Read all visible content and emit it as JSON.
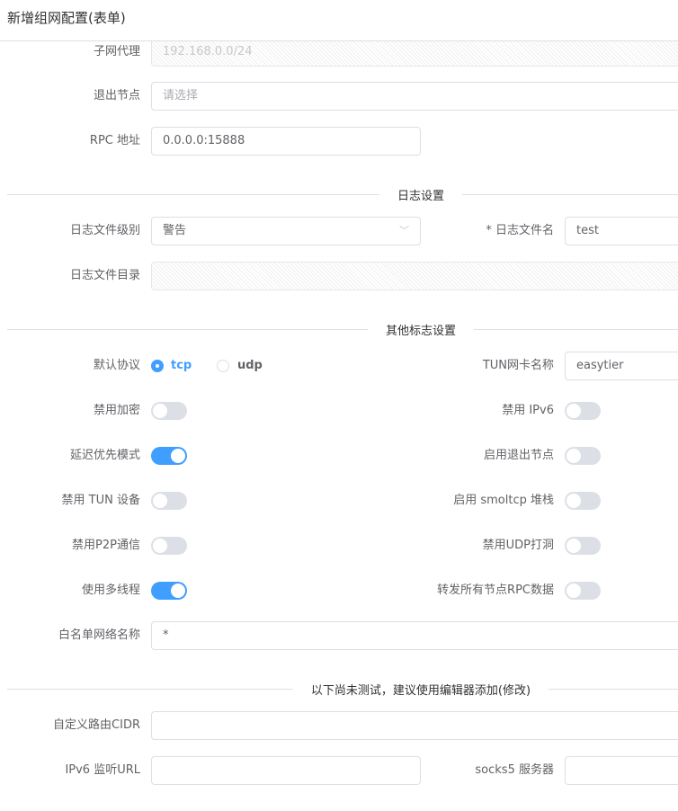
{
  "header": {
    "title": "新增组网配置(表单)"
  },
  "basic": {
    "subnet_proxy": {
      "label": "子网代理",
      "value": "192.168.0.0/24"
    },
    "exit_nodes": {
      "label": "退出节点",
      "placeholder": "请选择"
    },
    "rpc": {
      "label": "RPC 地址",
      "value": "0.0.0.0:15888"
    }
  },
  "log_section": {
    "title": "日志设置",
    "level": {
      "label": "日志文件级别",
      "value": "警告"
    },
    "filename": {
      "label": "* 日志文件名",
      "value": "test"
    },
    "dir": {
      "label": "日志文件目录",
      "value": ""
    }
  },
  "flags_section": {
    "title": "其他标志设置",
    "protocol": {
      "label": "默认协议",
      "options": [
        "tcp",
        "udp"
      ],
      "selected": "tcp"
    },
    "tun_name": {
      "label": "TUN网卡名称",
      "value": "easytier"
    },
    "switches_left": [
      {
        "label": "禁用加密",
        "on": false
      },
      {
        "label": "延迟优先模式",
        "on": true
      },
      {
        "label": "禁用 TUN 设备",
        "on": false
      },
      {
        "label": "禁用P2P通信",
        "on": false
      },
      {
        "label": "使用多线程",
        "on": true
      }
    ],
    "switches_right": [
      {
        "label": "禁用 IPv6",
        "on": false
      },
      {
        "label": "启用退出节点",
        "on": false
      },
      {
        "label": "启用 smoltcp 堆栈",
        "on": false
      },
      {
        "label": "禁用UDP打洞",
        "on": false
      },
      {
        "label": "转发所有节点RPC数据",
        "on": false
      }
    ],
    "whitelist": {
      "label": "白名单网络名称",
      "value": "*"
    }
  },
  "untested_section": {
    "title": "以下尚未测试，建议使用编辑器添加(修改)",
    "cidr": {
      "label": "自定义路由CIDR",
      "value": ""
    },
    "ipv6_url": {
      "label": "IPv6 监听URL",
      "value": ""
    },
    "socks5": {
      "label": "socks5 服务器",
      "value": ""
    }
  },
  "colors": {
    "accent": "#409eff",
    "border": "#dcdfe6",
    "switch_off": "#dcdfe6"
  }
}
